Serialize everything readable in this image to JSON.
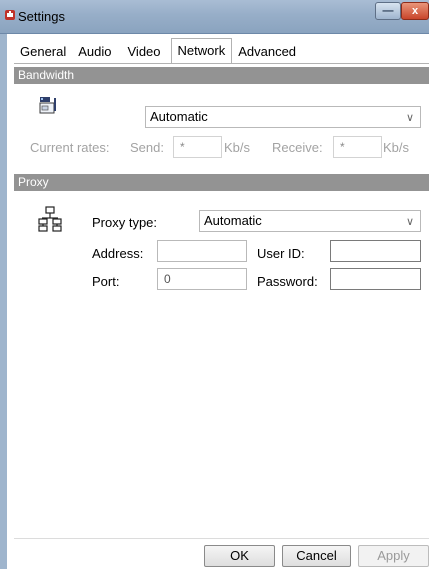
{
  "window": {
    "title": "Settings",
    "minimize_glyph": "—",
    "close_glyph": "x"
  },
  "tabs": [
    {
      "label": "General",
      "active": false
    },
    {
      "label": "Audio",
      "active": false
    },
    {
      "label": "Video",
      "active": false
    },
    {
      "label": "Network",
      "active": true
    },
    {
      "label": "Advanced",
      "active": false
    }
  ],
  "bandwidth": {
    "header": "Bandwidth",
    "mode_value": "Automatic",
    "current_rates_label": "Current rates:",
    "send_label": "Send:",
    "send_value": "*",
    "send_unit": "Kb/s",
    "receive_label": "Receive:",
    "receive_value": "*",
    "receive_unit": "Kb/s"
  },
  "proxy": {
    "header": "Proxy",
    "type_label": "Proxy type:",
    "type_value": "Automatic",
    "address_label": "Address:",
    "address_value": "",
    "port_label": "Port:",
    "port_value": "0",
    "userid_label": "User ID:",
    "userid_value": "",
    "password_label": "Password:",
    "password_value": ""
  },
  "buttons": {
    "ok": "OK",
    "cancel": "Cancel",
    "apply": "Apply"
  },
  "icons": {
    "app": "app-icon",
    "bandwidth": "network-adapter-icon",
    "proxy": "proxy-network-icon",
    "dropdown": "chevron-down-icon"
  },
  "colors": {
    "section_header_bg": "#939393",
    "title_bar": "#97aec8",
    "close_button": "#c9452b"
  }
}
